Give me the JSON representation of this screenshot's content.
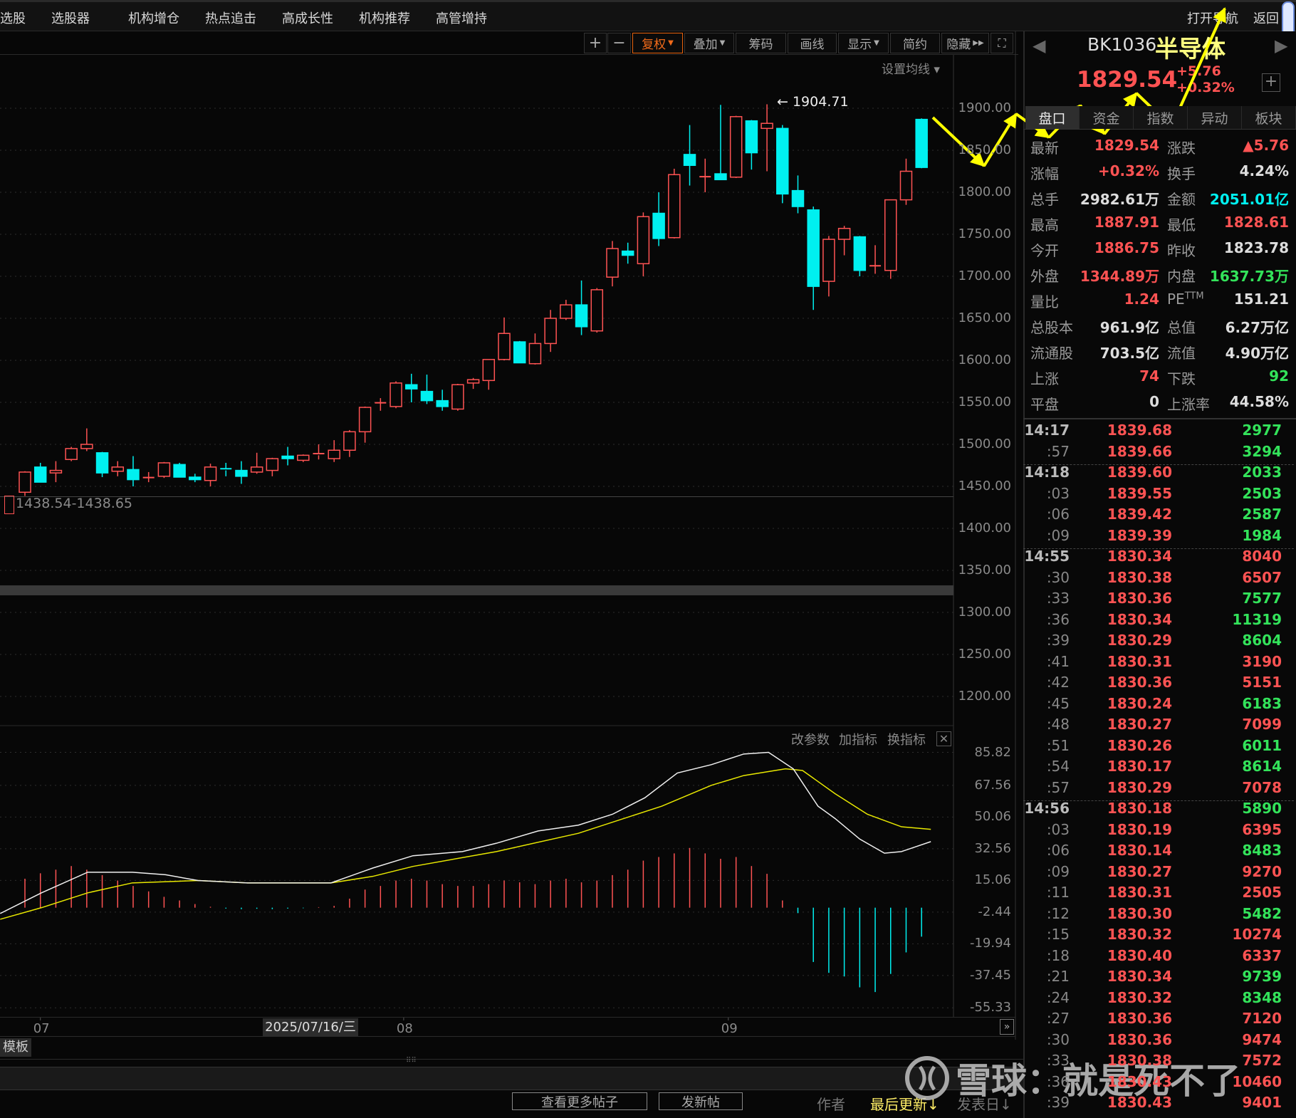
{
  "top_menu": [
    "选股",
    "选股器",
    "机构增仓",
    "热点追击",
    "高成长性",
    "机构推荐",
    "高管增持"
  ],
  "top_right": {
    "open_nav": "打开导航",
    "back": "返回"
  },
  "toolbar": {
    "zoom_in": "+",
    "zoom_out": "−",
    "fuquan": "复权",
    "overlay": "叠加",
    "chips": "筹码",
    "draw": "画线",
    "display": "显示",
    "simple": "简约",
    "hide": "隐藏",
    "set_ma": "设置均线 ▾"
  },
  "colors": {
    "up": "#ff5353",
    "down": "#00f0f0",
    "green": "#33e35a",
    "bg": "#070707",
    "accent": "#f06a1a",
    "yellow": "#ffff00"
  },
  "chart_data": {
    "type": "candlestick",
    "price_ticks": [
      1900,
      1850,
      1800,
      1750,
      1700,
      1650,
      1600,
      1550,
      1500,
      1450,
      1400,
      1350,
      1300,
      1250,
      1200
    ],
    "price_tick_labels": [
      "1900.00",
      "1850.00",
      "1800.00",
      "1750.00",
      "1700.00",
      "1650.00",
      "1600.00",
      "1550.00",
      "1500.00",
      "1450.00",
      "1400.00",
      "1350.00",
      "1300.00",
      "1250.00",
      "1200.00"
    ],
    "high_marker": "1904.71",
    "low_marker": "1438.54-1438.65",
    "low_value": 1438.6,
    "candles": [
      [
        1443,
        1468,
        1438.6,
        1467
      ],
      [
        1473,
        1478,
        1455,
        1455
      ],
      [
        1466,
        1480,
        1455,
        1469
      ],
      [
        1482,
        1497,
        1480,
        1495
      ],
      [
        1495,
        1519,
        1492,
        1500
      ],
      [
        1490,
        1491,
        1461,
        1466
      ],
      [
        1468,
        1480,
        1462,
        1473
      ],
      [
        1470,
        1486,
        1450,
        1458
      ],
      [
        1460,
        1467,
        1455,
        1460.5
      ],
      [
        1462,
        1479,
        1460,
        1478
      ],
      [
        1476,
        1478,
        1461,
        1461
      ],
      [
        1461,
        1465,
        1455,
        1458
      ],
      [
        1457,
        1477,
        1450,
        1473
      ],
      [
        1471,
        1478,
        1462,
        1469
      ],
      [
        1469,
        1480,
        1453,
        1462
      ],
      [
        1467,
        1490,
        1465,
        1473
      ],
      [
        1469,
        1484,
        1462,
        1483
      ],
      [
        1486,
        1497,
        1475,
        1483
      ],
      [
        1481,
        1488,
        1479,
        1487
      ],
      [
        1487,
        1500,
        1482,
        1489
      ],
      [
        1483,
        1505,
        1479,
        1493
      ],
      [
        1493,
        1517,
        1485,
        1515
      ],
      [
        1515,
        1545,
        1502,
        1544
      ],
      [
        1549,
        1555,
        1540,
        1549.5
      ],
      [
        1545,
        1575,
        1543,
        1573
      ],
      [
        1571,
        1584,
        1550,
        1566
      ],
      [
        1563,
        1583,
        1548,
        1552
      ],
      [
        1552,
        1565,
        1540,
        1545
      ],
      [
        1542,
        1572,
        1540,
        1571
      ],
      [
        1573,
        1579,
        1566,
        1577
      ],
      [
        1576,
        1601,
        1565,
        1601
      ],
      [
        1601,
        1651,
        1600,
        1632
      ],
      [
        1622,
        1623,
        1597,
        1597
      ],
      [
        1596,
        1632,
        1595,
        1620
      ],
      [
        1620,
        1660,
        1610,
        1650
      ],
      [
        1650,
        1672,
        1648,
        1666
      ],
      [
        1666,
        1695,
        1630,
        1640
      ],
      [
        1635,
        1686,
        1633,
        1684
      ],
      [
        1699,
        1742,
        1688,
        1733
      ],
      [
        1730,
        1740,
        1715,
        1725
      ],
      [
        1715,
        1776,
        1700,
        1771
      ],
      [
        1775,
        1800,
        1736,
        1745
      ],
      [
        1746,
        1828,
        1745,
        1821
      ],
      [
        1845,
        1880,
        1808,
        1832
      ],
      [
        1818,
        1840,
        1800,
        1818.5
      ],
      [
        1822,
        1904,
        1815,
        1815
      ],
      [
        1818,
        1891,
        1817,
        1890
      ],
      [
        1885,
        1886,
        1827,
        1847
      ],
      [
        1876,
        1904.71,
        1825,
        1882
      ],
      [
        1876,
        1880,
        1787,
        1798
      ],
      [
        1802,
        1820,
        1775,
        1783
      ],
      [
        1779,
        1783,
        1660,
        1688
      ],
      [
        1694,
        1748,
        1676,
        1744
      ],
      [
        1744,
        1760,
        1725,
        1757
      ],
      [
        1747,
        1748,
        1700,
        1707
      ],
      [
        1712,
        1737,
        1703,
        1712.5
      ],
      [
        1707,
        1791,
        1697,
        1791
      ],
      [
        1791,
        1840,
        1785,
        1825
      ],
      [
        1886.75,
        1887.91,
        1828.61,
        1829.54
      ]
    ],
    "x_labels": [
      {
        "index": 1,
        "text": "07"
      },
      {
        "index": 24.5,
        "text": "08"
      },
      {
        "index": 45.5,
        "text": "09"
      }
    ],
    "cursor_date": "2025/07/16/三",
    "indicator": {
      "header": {
        "params": "改参数",
        "add": "加指标",
        "switch": "换指标"
      },
      "ticks": [
        85.82,
        67.56,
        50.06,
        32.56,
        15.06,
        -2.44,
        -19.94,
        -37.45,
        -55.33
      ],
      "tick_labels": [
        "85.82",
        "67.56",
        "50.06",
        "32.56",
        "15.06",
        "-2.44",
        "-19.94",
        "-37.45",
        "-55.33"
      ],
      "white_line": [
        [
          -1.6,
          -3.2
        ],
        [
          1.07,
          8.2
        ],
        [
          4.06,
          19.6
        ],
        [
          6.95,
          19.6
        ],
        [
          9.1,
          18.2
        ],
        [
          11.2,
          15.0
        ],
        [
          14.4,
          13.7
        ],
        [
          19.8,
          13.7
        ],
        [
          22.5,
          21.9
        ],
        [
          25.1,
          28.7
        ],
        [
          28.3,
          31.0
        ],
        [
          30.5,
          35.6
        ],
        [
          33.2,
          42.4
        ],
        [
          35.8,
          45.6
        ],
        [
          38.0,
          51.6
        ],
        [
          40.1,
          60.7
        ],
        [
          42.2,
          74.4
        ],
        [
          44.4,
          79.0
        ],
        [
          46.5,
          84.9
        ],
        [
          48.1,
          85.8
        ],
        [
          49.7,
          76.7
        ],
        [
          51.3,
          56.1
        ],
        [
          52.4,
          49.3
        ],
        [
          54.0,
          37.9
        ],
        [
          55.6,
          30.1
        ],
        [
          56.7,
          31.0
        ],
        [
          58.6,
          36.5
        ]
      ],
      "yellow_line": [
        [
          -1.6,
          -6.4
        ],
        [
          1.07,
          0
        ],
        [
          4.06,
          8.2
        ],
        [
          6.95,
          13.7
        ],
        [
          11.2,
          15.0
        ],
        [
          14.4,
          13.7
        ],
        [
          19.8,
          13.7
        ],
        [
          22.5,
          17.3
        ],
        [
          25.1,
          22.8
        ],
        [
          30.5,
          31.0
        ],
        [
          35.8,
          41.1
        ],
        [
          41.2,
          56.1
        ],
        [
          44.4,
          67.6
        ],
        [
          46.5,
          73.0
        ],
        [
          49.2,
          76.7
        ],
        [
          50.3,
          75.8
        ],
        [
          52.4,
          63.0
        ],
        [
          54.5,
          51.6
        ],
        [
          56.7,
          44.7
        ],
        [
          58.6,
          43.3
        ]
      ],
      "bars": [
        16,
        19,
        21,
        23,
        21,
        18,
        15,
        12,
        9,
        6,
        4,
        2,
        0.5,
        -0.5,
        -0.8,
        -0.6,
        -0.8,
        -0.5,
        -0.3,
        0.3,
        1,
        5,
        10,
        12,
        15,
        16,
        15,
        13,
        12,
        12,
        13,
        15,
        14,
        13,
        15,
        16,
        14,
        15,
        18,
        21,
        26,
        28,
        30,
        33,
        30,
        27,
        28,
        23,
        18.7,
        4,
        -3,
        -30,
        -36,
        -38,
        -44,
        -46.6,
        -36.6,
        -24.7,
        -16
      ]
    }
  },
  "bottom": {
    "template": "模板",
    "more_posts": "查看更多帖子",
    "new_post": "发新帖",
    "author": "作者",
    "last_update": "最后更新↓",
    "post_date": "发表日↓"
  },
  "quote": {
    "code": "BK1036",
    "name": "半导体",
    "price": "1829.54",
    "change": "+5.76",
    "change_pct": "+0.32%",
    "tabs": [
      "盘口",
      "资金",
      "指数",
      "异动",
      "板块"
    ],
    "rows": [
      {
        "l1": "最新",
        "v1": "1829.54",
        "c1": "#ff5353",
        "l2": "涨跌",
        "v2": "▲5.76",
        "c2": "#ff5353"
      },
      {
        "l1": "涨幅",
        "v1": "+0.32%",
        "c1": "#ff5353",
        "l2": "换手",
        "v2": "4.24%",
        "c2": "#dddddd"
      },
      {
        "l1": "总手",
        "v1": "2982.61万",
        "c1": "#dddddd",
        "l2": "金额",
        "v2": "2051.01亿",
        "c2": "#00f0f0"
      },
      {
        "l1": "最高",
        "v1": "1887.91",
        "c1": "#ff5353",
        "l2": "最低",
        "v2": "1828.61",
        "c2": "#ff5353"
      },
      {
        "l1": "今开",
        "v1": "1886.75",
        "c1": "#ff5353",
        "l2": "昨收",
        "v2": "1823.78",
        "c2": "#dddddd"
      },
      {
        "l1": "外盘",
        "v1": "1344.89万",
        "c1": "#ff5353",
        "l2": "内盘",
        "v2": "1637.73万",
        "c2": "#33e35a"
      },
      {
        "l1": "量比",
        "v1": "1.24",
        "c1": "#ff5353",
        "l2": "PE",
        "l2sup": "TTM",
        "v2": "151.21",
        "c2": "#dddddd"
      },
      {
        "l1": "总股本",
        "v1": "961.9亿",
        "c1": "#dddddd",
        "l2": "总值",
        "v2": "6.27万亿",
        "c2": "#dddddd"
      },
      {
        "l1": "流通股",
        "v1": "703.5亿",
        "c1": "#dddddd",
        "l2": "流值",
        "v2": "4.90万亿",
        "c2": "#dddddd"
      },
      {
        "l1": "上涨",
        "v1": "74",
        "c1": "#ff5353",
        "l2": "下跌",
        "v2": "92",
        "c2": "#33e35a"
      },
      {
        "l1": "平盘",
        "v1": "0",
        "c1": "#dddddd",
        "l2": "上涨率",
        "v2": "44.58%",
        "c2": "#dddddd"
      }
    ]
  },
  "ticks": [
    {
      "t": "14:17",
      "p": "1839.68",
      "v": "2977",
      "vc": "#33e35a",
      "b": true
    },
    {
      "t": ":57",
      "p": "1839.66",
      "v": "3294",
      "vc": "#33e35a"
    },
    {
      "t": "14:18",
      "p": "1839.60",
      "v": "2033",
      "vc": "#33e35a",
      "b": true
    },
    {
      "t": ":03",
      "p": "1839.55",
      "v": "2503",
      "vc": "#33e35a"
    },
    {
      "t": ":06",
      "p": "1839.42",
      "v": "2587",
      "vc": "#33e35a"
    },
    {
      "t": ":09",
      "p": "1839.39",
      "v": "1984",
      "vc": "#33e35a"
    },
    {
      "t": "14:55",
      "p": "1830.34",
      "v": "8040",
      "vc": "#ff5353",
      "b": true
    },
    {
      "t": ":30",
      "p": "1830.38",
      "v": "6507",
      "vc": "#ff5353"
    },
    {
      "t": ":33",
      "p": "1830.36",
      "v": "7577",
      "vc": "#33e35a"
    },
    {
      "t": ":36",
      "p": "1830.34",
      "v": "11319",
      "vc": "#33e35a"
    },
    {
      "t": ":39",
      "p": "1830.29",
      "v": "8604",
      "vc": "#33e35a"
    },
    {
      "t": ":41",
      "p": "1830.31",
      "v": "3190",
      "vc": "#ff5353"
    },
    {
      "t": ":42",
      "p": "1830.36",
      "v": "5151",
      "vc": "#ff5353"
    },
    {
      "t": ":45",
      "p": "1830.24",
      "v": "6183",
      "vc": "#33e35a"
    },
    {
      "t": ":48",
      "p": "1830.27",
      "v": "7099",
      "vc": "#ff5353"
    },
    {
      "t": ":51",
      "p": "1830.26",
      "v": "6011",
      "vc": "#33e35a"
    },
    {
      "t": ":54",
      "p": "1830.17",
      "v": "8614",
      "vc": "#33e35a"
    },
    {
      "t": ":57",
      "p": "1830.29",
      "v": "7078",
      "vc": "#ff5353"
    },
    {
      "t": "14:56",
      "p": "1830.18",
      "v": "5890",
      "vc": "#33e35a",
      "b": true
    },
    {
      "t": ":03",
      "p": "1830.19",
      "v": "6395",
      "vc": "#ff5353"
    },
    {
      "t": ":06",
      "p": "1830.14",
      "v": "8483",
      "vc": "#33e35a"
    },
    {
      "t": ":09",
      "p": "1830.27",
      "v": "9270",
      "vc": "#ff5353"
    },
    {
      "t": ":11",
      "p": "1830.31",
      "v": "2505",
      "vc": "#ff5353"
    },
    {
      "t": ":12",
      "p": "1830.30",
      "v": "5482",
      "vc": "#33e35a"
    },
    {
      "t": ":15",
      "p": "1830.32",
      "v": "10274",
      "vc": "#ff5353"
    },
    {
      "t": ":18",
      "p": "1830.40",
      "v": "6337",
      "vc": "#ff5353"
    },
    {
      "t": ":21",
      "p": "1830.34",
      "v": "9739",
      "vc": "#33e35a"
    },
    {
      "t": ":24",
      "p": "1830.32",
      "v": "8348",
      "vc": "#33e35a"
    },
    {
      "t": ":27",
      "p": "1830.36",
      "v": "7120",
      "vc": "#ff5353"
    },
    {
      "t": ":30",
      "p": "1830.36",
      "v": "9474",
      "vc": "#ff5353"
    },
    {
      "t": ":33",
      "p": "1830.38",
      "v": "7572",
      "vc": "#ff5353"
    },
    {
      "t": ":36",
      "p": "1830.43",
      "v": "10460",
      "vc": "#ff5353"
    },
    {
      "t": ":39",
      "p": "1830.43",
      "v": "9401",
      "vc": "#ff5353"
    }
  ],
  "watermark": "雪球：就是死不了"
}
